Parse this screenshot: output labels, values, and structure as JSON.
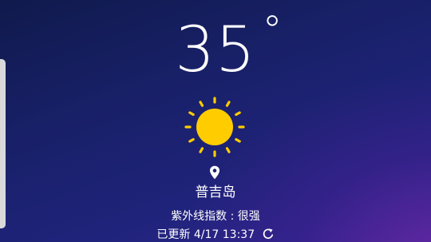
{
  "weather": {
    "temperature": "35",
    "degree_symbol": "°",
    "condition_icon": "sun-icon",
    "location_icon": "location-pin-icon",
    "city": "普吉岛",
    "uv_label": "紫外线指数 : 很强",
    "updated_label": "已更新 4/17 13:37",
    "refresh_icon": "refresh-icon"
  },
  "colors": {
    "sun": "#ffcc00",
    "text": "#ffffff",
    "background_top": "#101a4c",
    "background_bottom": "#2b2590"
  }
}
